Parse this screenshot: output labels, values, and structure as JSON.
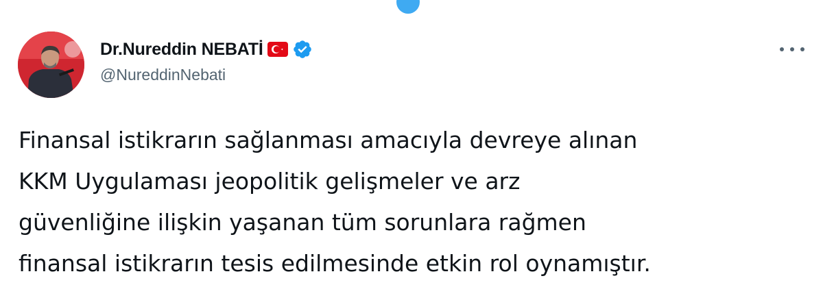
{
  "tweet": {
    "author": {
      "display_name": "Dr.Nureddin NEBATİ",
      "handle": "@NureddinNebati",
      "flag_icon": "turkey-flag-icon",
      "verified_icon": "verified-badge-icon",
      "avatar": "profile-photo"
    },
    "more_icon": "more-options-icon",
    "text_lines": [
      "Finansal istikrarın sağlanması amacıyla devreye alınan",
      "KKM Uygulaması jeopolitik gelişmeler ve arz",
      "güvenliğine ilişkin yaşanan tüm sorunlara rağmen",
      "finansal istikrarın tesis edilmesinde etkin rol oynamıştır."
    ]
  },
  "colors": {
    "text_primary": "#0f1419",
    "text_secondary": "#536471",
    "verified_blue": "#1d9bf0",
    "flag_red": "#e30a17"
  }
}
